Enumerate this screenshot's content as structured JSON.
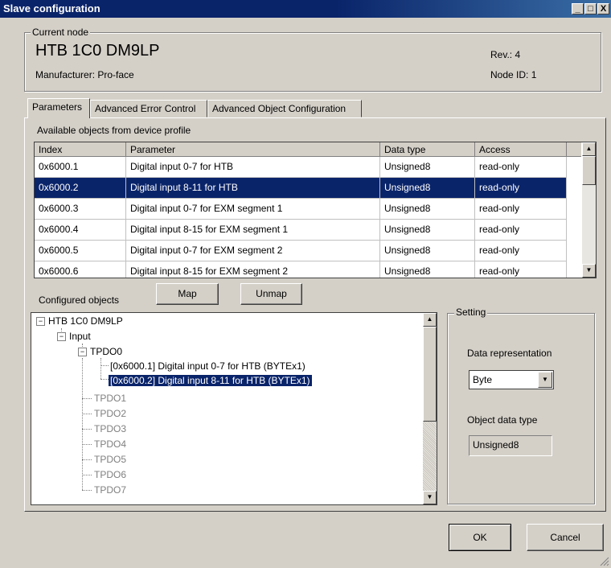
{
  "window": {
    "title": "Slave configuration",
    "controls": [
      "_",
      "□",
      "X"
    ]
  },
  "current_node": {
    "legend": "Current node",
    "name": "HTB 1C0 DM9LP",
    "manufacturer": "Manufacturer: Pro-face",
    "rev": "Rev.: 4",
    "node_id": "Node ID: 1"
  },
  "tabs": [
    {
      "label": "Parameters",
      "active": true
    },
    {
      "label": "Advanced Error Control",
      "active": false
    },
    {
      "label": "Advanced Object Configuration",
      "active": false
    }
  ],
  "available": {
    "caption": "Available objects from device profile",
    "columns": [
      "Index",
      "Parameter",
      "Data type",
      "Access"
    ],
    "rows": [
      [
        "0x6000.1",
        "Digital input 0-7 for HTB",
        "Unsigned8",
        "read-only"
      ],
      [
        "0x6000.2",
        "Digital input 8-11 for HTB",
        "Unsigned8",
        "read-only"
      ],
      [
        "0x6000.3",
        "Digital input 0-7 for EXM segment 1",
        "Unsigned8",
        "read-only"
      ],
      [
        "0x6000.4",
        "Digital input 8-15 for EXM segment 1",
        "Unsigned8",
        "read-only"
      ],
      [
        "0x6000.5",
        "Digital input 0-7 for EXM segment 2",
        "Unsigned8",
        "read-only"
      ],
      [
        "0x6000.6",
        "Digital input 8-15 for EXM segment 2",
        "Unsigned8",
        "read-only"
      ]
    ],
    "selected_row": 1
  },
  "buttons": {
    "map": "Map",
    "unmap": "Unmap",
    "ok": "OK",
    "cancel": "Cancel"
  },
  "configured": {
    "caption": "Configured objects",
    "root": "HTB 1C0 DM9LP",
    "input": "Input",
    "tpdo0": "TPDO0",
    "entries": [
      "[0x6000.1] Digital input 0-7 for HTB   (BYTEx1)",
      "[0x6000.2] Digital input 8-11 for HTB   (BYTEx1)"
    ],
    "others": [
      "TPDO1",
      "TPDO2",
      "TPDO3",
      "TPDO4",
      "TPDO5",
      "TPDO6",
      "TPDO7"
    ]
  },
  "setting": {
    "legend": "Setting",
    "data_rep_label": "Data representation",
    "data_rep_value": "Byte",
    "object_type_label": "Object data type",
    "object_type_value": "Unsigned8"
  },
  "colors": {
    "selection": "#0a246a",
    "face": "#d4d0c8"
  }
}
